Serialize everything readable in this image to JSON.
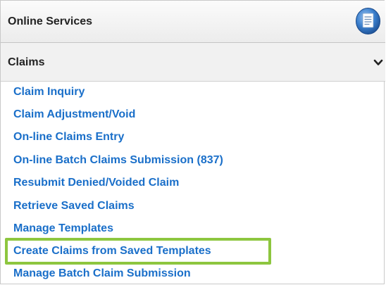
{
  "header": {
    "title": "Online Services",
    "icon": "document-icon"
  },
  "section": {
    "title": "Claims",
    "toggle_icon": "chevron-down-icon",
    "expanded": true
  },
  "menu": {
    "items": [
      {
        "label": "Claim Inquiry"
      },
      {
        "label": "Claim Adjustment/Void"
      },
      {
        "label": "On-line Claims Entry"
      },
      {
        "label": "On-line Batch Claims Submission (837)"
      },
      {
        "label": "Resubmit Denied/Voided Claim"
      },
      {
        "label": "Retrieve Saved Claims"
      },
      {
        "label": "Manage Templates"
      },
      {
        "label": "Create Claims from Saved Templates",
        "highlighted": true
      },
      {
        "label": "Manage Batch Claim Submission"
      }
    ]
  },
  "colors": {
    "link": "#1a6fc9",
    "highlight": "#8dc63f",
    "icon_blue": "#2f6db5"
  }
}
